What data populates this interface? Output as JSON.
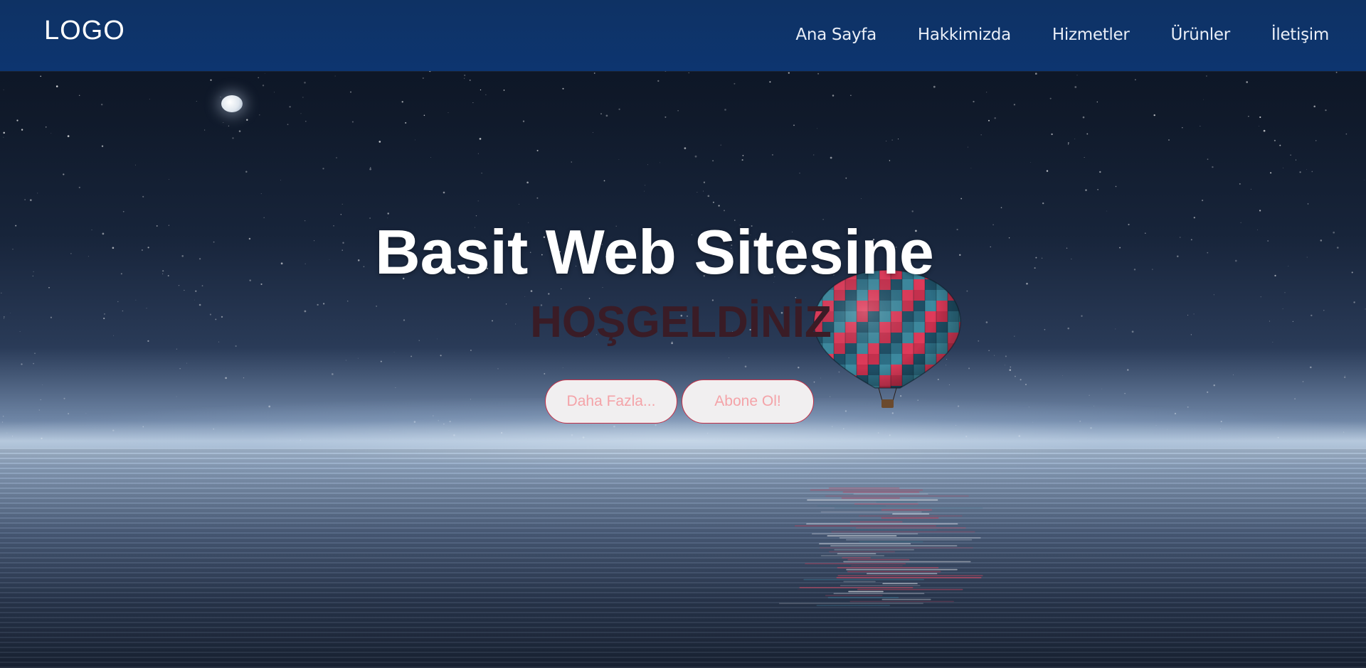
{
  "header": {
    "logo": "LOGO",
    "nav": [
      {
        "label": "Ana Sayfa"
      },
      {
        "label": "Hakkimizda"
      },
      {
        "label": "Hizmetler"
      },
      {
        "label": "Ürünler"
      },
      {
        "label": "İletişim"
      }
    ]
  },
  "hero": {
    "title": "Basit Web Sitesine",
    "subtitle": "HOŞGELDİNİZ",
    "buttons": {
      "more": "Daha Fazla...",
      "subscribe": "Abone Ol!"
    }
  },
  "colors": {
    "header_bg": "#0d3570",
    "subtitle": "#3a1c26",
    "button_text": "#f4a3a8",
    "button_border": "#c43048"
  }
}
